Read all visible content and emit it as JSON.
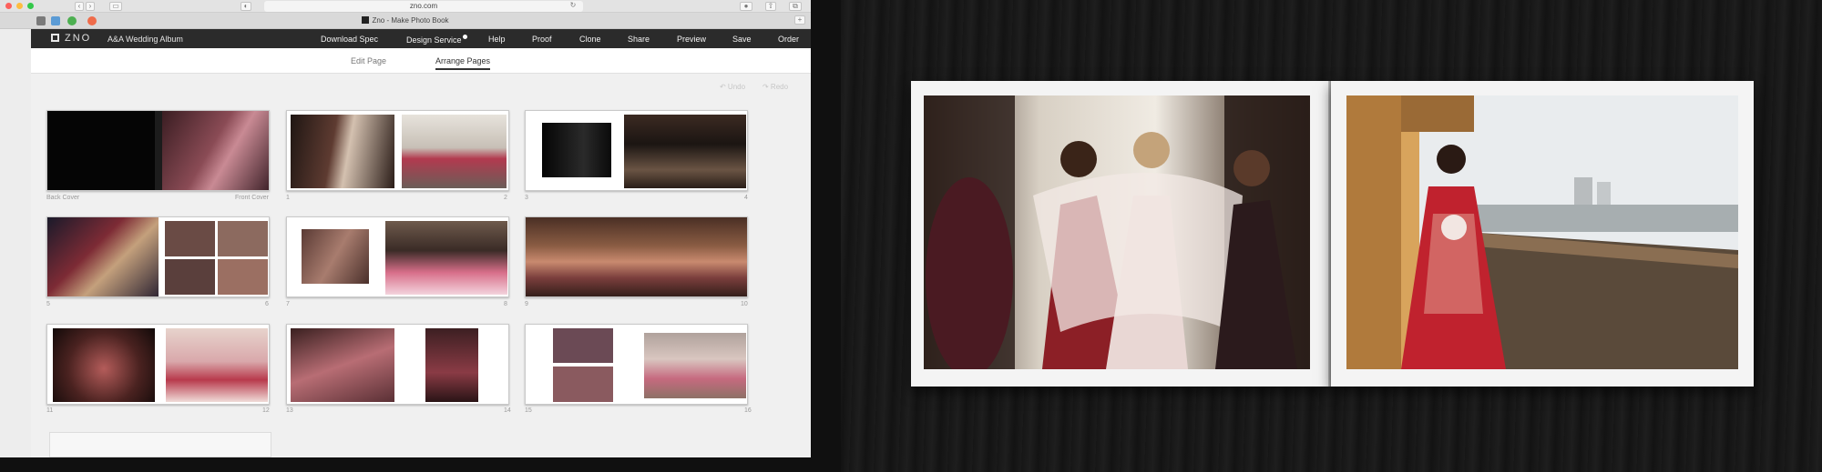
{
  "browser": {
    "url": "zno.com",
    "tab_title": "Zno - Make Photo Book"
  },
  "app": {
    "album_title": "A&A Wedding Album",
    "nav": {
      "download_spec": "Download Spec",
      "design_service": "Design Service",
      "help": "Help",
      "proof": "Proof",
      "clone": "Clone",
      "share": "Share",
      "preview": "Preview",
      "save": "Save",
      "order": "Order"
    },
    "tabs": {
      "edit_page": "Edit Page",
      "arrange_pages": "Arrange Pages"
    },
    "undo_label": "↶ Undo",
    "redo_label": "↷ Redo",
    "spreads": [
      {
        "left_label": "Back Cover",
        "right_label": "Front Cover"
      },
      {
        "left_label": "1",
        "right_label": "2"
      },
      {
        "left_label": "3",
        "right_label": "4"
      },
      {
        "left_label": "5",
        "right_label": "6"
      },
      {
        "left_label": "7",
        "right_label": "8"
      },
      {
        "left_label": "9",
        "right_label": "10"
      },
      {
        "left_label": "11",
        "right_label": "12"
      },
      {
        "left_label": "13",
        "right_label": "14"
      },
      {
        "left_label": "15",
        "right_label": "16"
      }
    ]
  },
  "colors": {
    "nav_bg": "#2b2b2b",
    "app_bg": "#f0f0f0",
    "photo_bg": "#161616"
  }
}
